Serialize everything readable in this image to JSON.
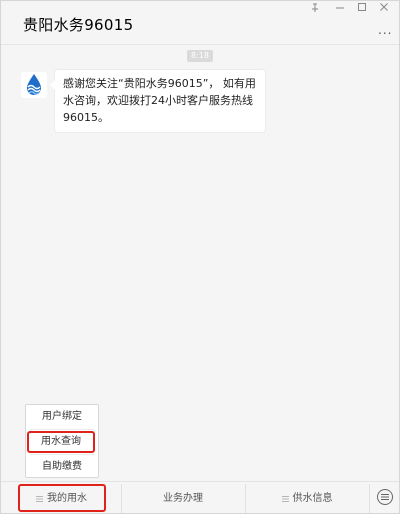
{
  "header": {
    "title": "贵阳水务96015",
    "more_label": "..."
  },
  "chat": {
    "time": "8:18",
    "message": "感谢您关注“贵阳水务96015”， 如有用水咨询，欢迎拨打24小时客户服务热线96015。"
  },
  "popup": {
    "items": [
      "用户绑定",
      "用水查询",
      "自助缴费"
    ]
  },
  "footer": {
    "tabs": [
      "我的用水",
      "业务办理",
      "供水信息"
    ]
  },
  "colors": {
    "highlight": "#e0231a",
    "brand_blue": "#1f6fc9"
  }
}
